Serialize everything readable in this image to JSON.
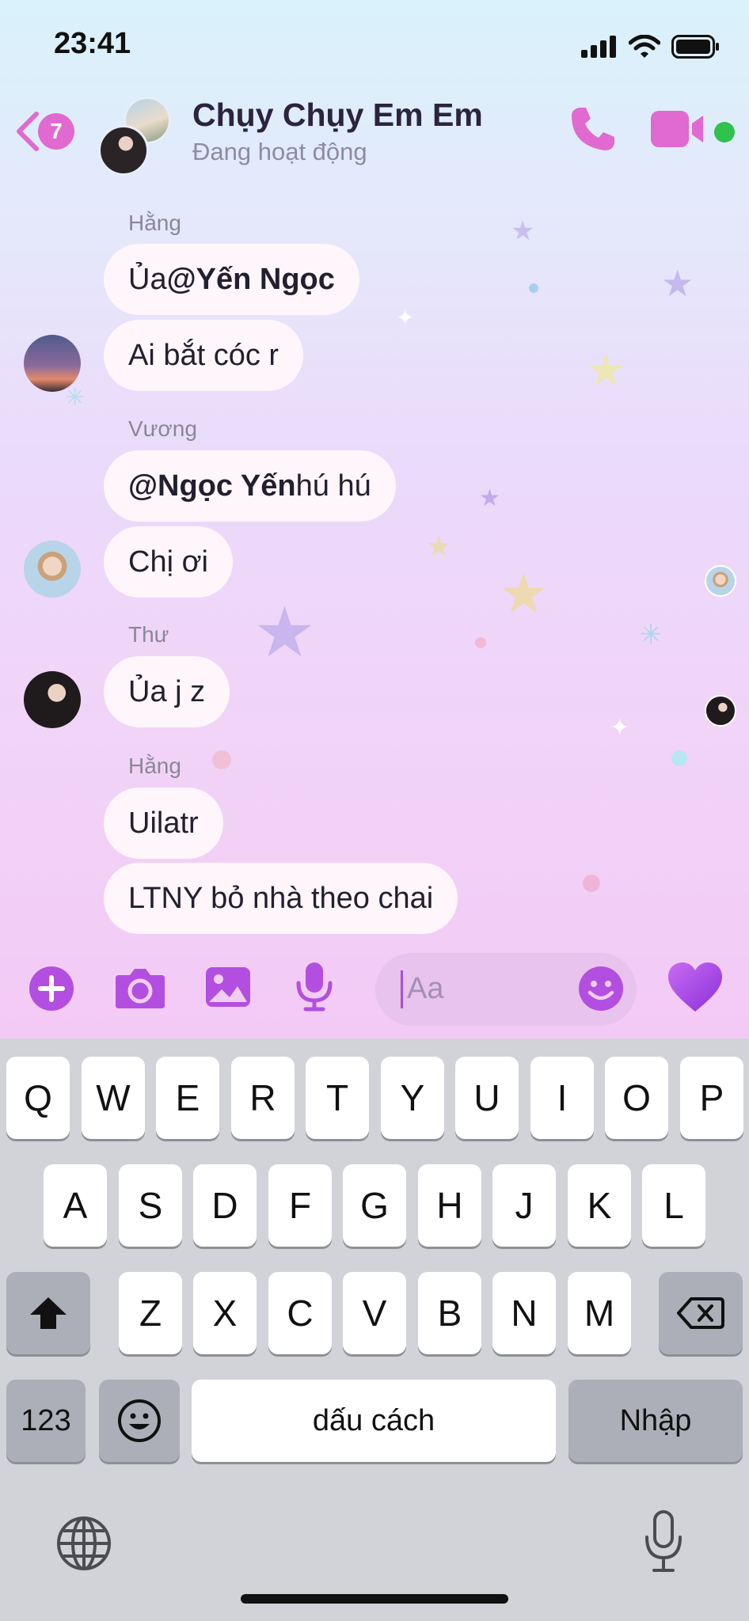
{
  "status_bar": {
    "time": "23:41"
  },
  "header": {
    "back_count": "7",
    "title": "Chụy Chụy Em Em",
    "subtitle": "Đang hoạt động"
  },
  "messages": [
    {
      "sender": "Hằng",
      "bubbles": [
        {
          "prefix": "Ủa ",
          "mention": "@Yến Ngọc",
          "suffix": ""
        },
        {
          "text": "Ai bắt cóc r"
        }
      ]
    },
    {
      "sender": "Vương",
      "bubbles": [
        {
          "prefix": "",
          "mention": "@Ngọc Yến",
          "suffix": " hú hú"
        },
        {
          "text": "Chị ơi"
        }
      ]
    },
    {
      "sender": "Thư",
      "bubbles": [
        {
          "text": "Ủa j z"
        }
      ]
    },
    {
      "sender": "Hằng",
      "bubbles": [
        {
          "text": "Uilatr"
        },
        {
          "text": "LTNY bỏ nhà theo chai"
        }
      ]
    }
  ],
  "composer": {
    "placeholder": "Aa",
    "icons": [
      "plus-icon",
      "camera-icon",
      "image-icon",
      "microphone-icon",
      "emoji-icon",
      "heart-icon"
    ]
  },
  "keyboard": {
    "row1": [
      "Q",
      "W",
      "E",
      "R",
      "T",
      "Y",
      "U",
      "I",
      "O",
      "P"
    ],
    "row2": [
      "A",
      "S",
      "D",
      "F",
      "G",
      "H",
      "J",
      "K",
      "L"
    ],
    "row3": [
      "Z",
      "X",
      "C",
      "V",
      "B",
      "N",
      "M"
    ],
    "numbers_label": "123",
    "space_label": "dấu cách",
    "return_label": "Nhập"
  },
  "colors": {
    "accent": "#b24fe0",
    "accent_pink": "#e06ad0",
    "online": "#31c24d",
    "heart": "#a240e8"
  }
}
